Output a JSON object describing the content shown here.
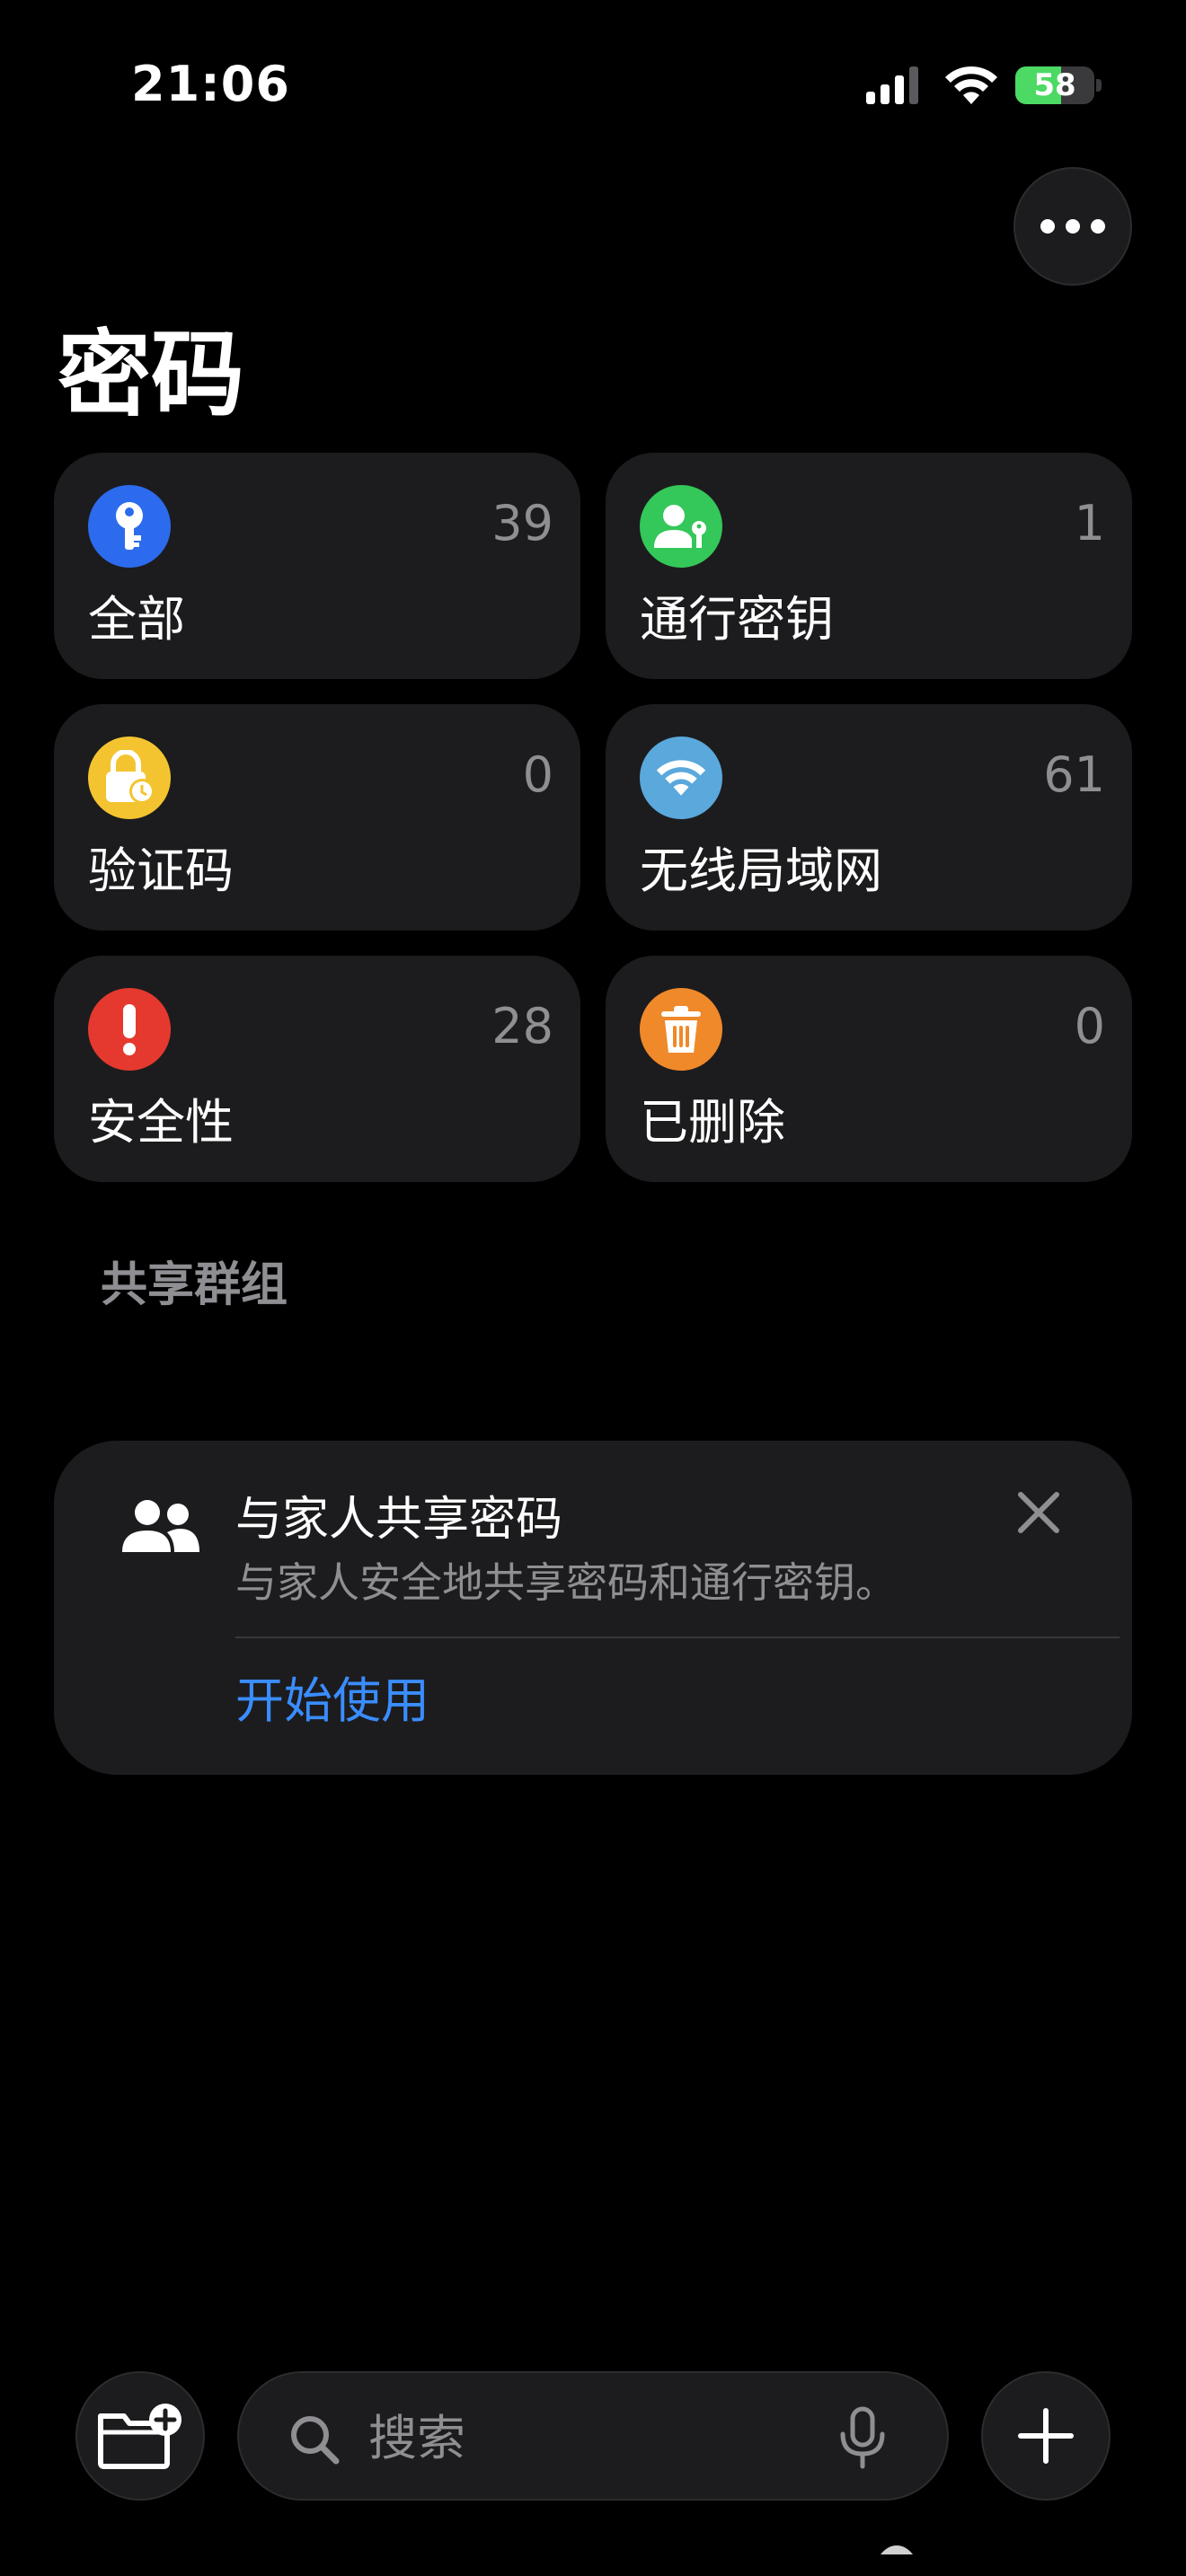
{
  "status_bar": {
    "time": "21:06",
    "battery_text": "58",
    "battery_level": 0.58
  },
  "icons": {
    "more": "ellipsis-icon",
    "all": "key-icon",
    "passkeys": "person-key-icon",
    "codes": "lock-clock-icon",
    "wifi": "wifi-icon",
    "security": "exclamation-icon",
    "deleted": "trash-icon",
    "share": "people-icon",
    "close": "close-icon",
    "folder": "folder-add-icon",
    "search": "search-icon",
    "mic": "microphone-icon",
    "add": "plus-icon"
  },
  "page": {
    "title": "密码"
  },
  "categories": [
    {
      "label": "全部",
      "count": "39",
      "color": "#2c6bed"
    },
    {
      "label": "通行密钥",
      "count": "1",
      "color": "#34c759"
    },
    {
      "label": "验证码",
      "count": "0",
      "color": "#f4c430"
    },
    {
      "label": "无线局域网",
      "count": "61",
      "color": "#5aa8dc"
    },
    {
      "label": "安全性",
      "count": "28",
      "color": "#e5392f"
    },
    {
      "label": "已删除",
      "count": "0",
      "color": "#f0892a"
    }
  ],
  "section": {
    "shared_groups": "共享群组"
  },
  "share_card": {
    "title": "与家人共享密码",
    "subtitle": "与家人安全地共享密码和通行密钥。",
    "action": "开始使用"
  },
  "search": {
    "placeholder": "搜索"
  },
  "colors": {
    "background": "#000000",
    "card": "#1c1c1e",
    "accent": "#3a8dff",
    "secondary_text": "#8e8e93"
  }
}
